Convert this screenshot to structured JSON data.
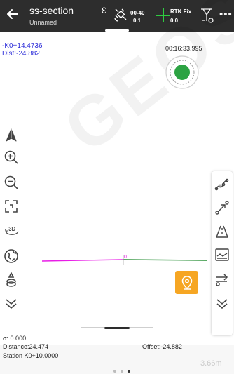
{
  "header": {
    "title": "ss-section",
    "subtitle": "Unnamed",
    "glyph": "Ɛ",
    "satellites": "00-40",
    "sat_age": "0.1",
    "fix_status": "RTK Fix",
    "fix_age": "0.0",
    "back_icon": "arrow-left-icon",
    "more_label": "•••",
    "accent": "#2d2d2d"
  },
  "map": {
    "station": "-K0+14.4736",
    "distance": "Dist:-24.882",
    "timer": "00:16:33.995",
    "watermark": "GEOSAT",
    "point_label": "0",
    "line_colors": {
      "left": "#e81de6",
      "right": "#1e8a2c"
    }
  },
  "left_toolbar": [
    {
      "icon": "north-arrow-icon"
    },
    {
      "icon": "zoom-in-icon"
    },
    {
      "icon": "zoom-out-icon"
    },
    {
      "icon": "zoom-extent-icon"
    },
    {
      "icon": "3d-view-icon",
      "label": "3D"
    },
    {
      "icon": "globe-icon"
    },
    {
      "icon": "layers-icon"
    },
    {
      "icon": "collapse-icon"
    }
  ],
  "right_toolbar": [
    {
      "icon": "polyline-icon"
    },
    {
      "icon": "stakeout-line-icon"
    },
    {
      "icon": "road-icon"
    },
    {
      "icon": "section-view-icon"
    },
    {
      "icon": "offset-icon"
    },
    {
      "icon": "collapse-icon"
    }
  ],
  "stake_button": {
    "icon": "location-pin-icon",
    "color": "#f6a623"
  },
  "info": {
    "sigma": "σ: 0.000",
    "distance": "Distance:24.474",
    "offset": "Offset:-24.882",
    "station": "Station K0+10.0000",
    "scale": "3.66m"
  },
  "pagination": {
    "count": 3,
    "active": 2
  }
}
